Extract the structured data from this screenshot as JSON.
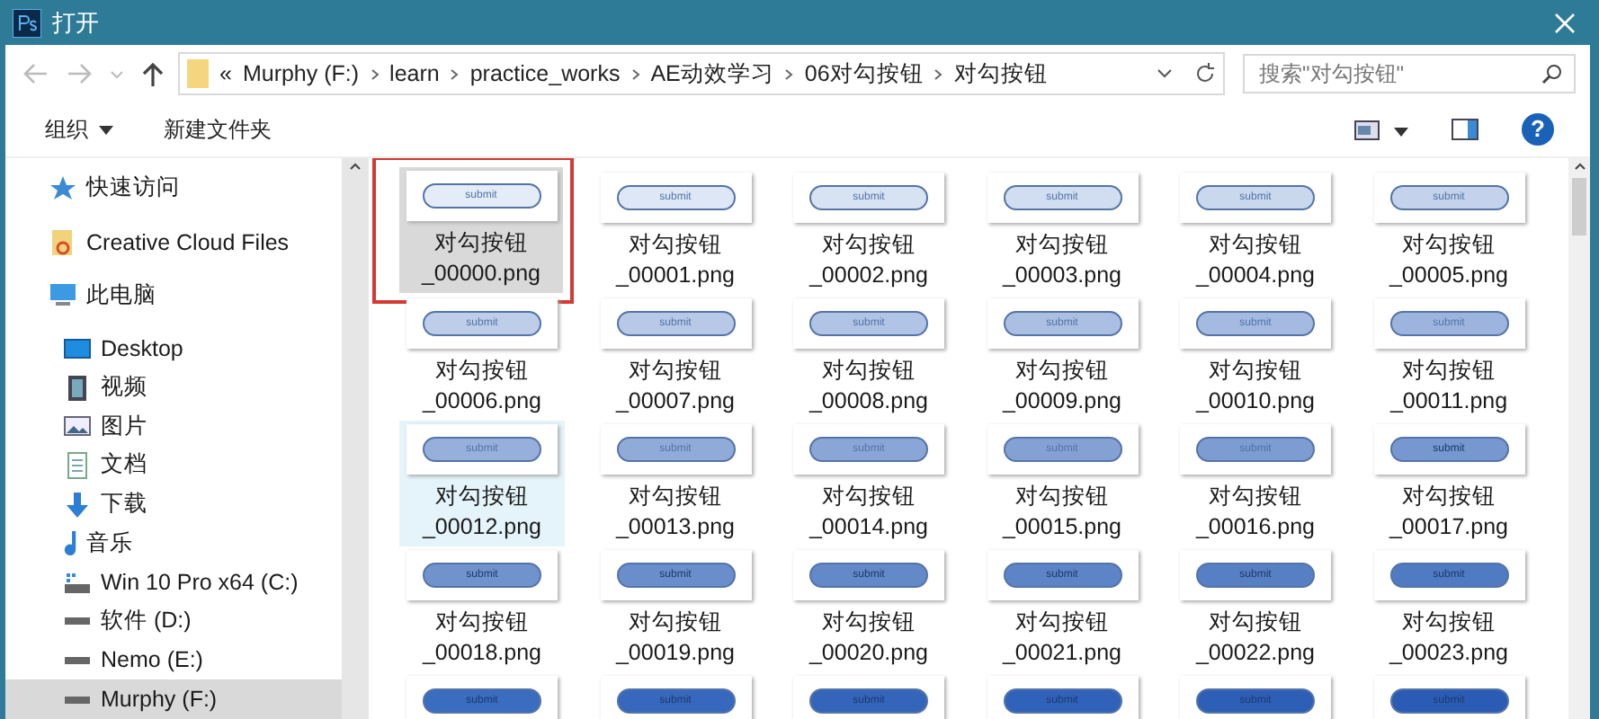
{
  "window": {
    "title": "打开"
  },
  "address_bar": {
    "overflow_mark": "«",
    "path": [
      "Murphy (F:)",
      "learn",
      "practice_works",
      "AE动效学习",
      "06对勾按钮",
      "对勾按钮"
    ]
  },
  "search": {
    "placeholder": "搜索\"对勾按钮\""
  },
  "toolbar": {
    "organize": "组织",
    "new_folder": "新建文件夹",
    "help": "?"
  },
  "sidebar": {
    "items": [
      {
        "label": "快速访问",
        "kind": "star",
        "selected": false
      },
      {
        "label": "Creative Cloud Files",
        "kind": "cloud",
        "selected": false
      },
      {
        "label": "此电脑",
        "kind": "pc",
        "selected": false,
        "children": [
          {
            "label": "Desktop",
            "kind": "desktop",
            "selected": false
          },
          {
            "label": "视频",
            "kind": "video",
            "selected": false
          },
          {
            "label": "图片",
            "kind": "pictures",
            "selected": false
          },
          {
            "label": "文档",
            "kind": "docs",
            "selected": false
          },
          {
            "label": "下载",
            "kind": "download",
            "selected": false
          },
          {
            "label": "音乐",
            "kind": "music",
            "selected": false
          },
          {
            "label": "Win 10 Pro x64 (C:)",
            "kind": "sysdrive",
            "selected": false
          },
          {
            "label": "软件 (D:)",
            "kind": "drive",
            "selected": false
          },
          {
            "label": "Nemo (E:)",
            "kind": "drive",
            "selected": false
          },
          {
            "label": "Murphy (F:)",
            "kind": "drive",
            "selected": true
          }
        ]
      }
    ]
  },
  "files": [
    {
      "name": "对勾按钮\n_00000.png",
      "thumb_text": "submit",
      "color": "#e4ecf7",
      "selected": true,
      "hovered": false,
      "marked": true
    },
    {
      "name": "对勾按钮\n_00001.png",
      "thumb_text": "submit",
      "color": "#dee7f5",
      "selected": false,
      "hovered": false,
      "marked": false
    },
    {
      "name": "对勾按钮\n_00002.png",
      "thumb_text": "submit",
      "color": "#d7e2f2",
      "selected": false,
      "hovered": false,
      "marked": false
    },
    {
      "name": "对勾按钮\n_00003.png",
      "thumb_text": "submit",
      "color": "#d1ddf0",
      "selected": false,
      "hovered": false,
      "marked": false
    },
    {
      "name": "对勾按钮\n_00004.png",
      "thumb_text": "submit",
      "color": "#cad8ee",
      "selected": false,
      "hovered": false,
      "marked": false
    },
    {
      "name": "对勾按钮\n_00005.png",
      "thumb_text": "submit",
      "color": "#c4d3eb",
      "selected": false,
      "hovered": false,
      "marked": false
    },
    {
      "name": "对勾按钮\n_00006.png",
      "thumb_text": "submit",
      "color": "#becee9",
      "selected": false,
      "hovered": false,
      "marked": false
    },
    {
      "name": "对勾按钮\n_00007.png",
      "thumb_text": "submit",
      "color": "#b7c9e7",
      "selected": false,
      "hovered": false,
      "marked": false
    },
    {
      "name": "对勾按钮\n_00008.png",
      "thumb_text": "submit",
      "color": "#b1c4e5",
      "selected": false,
      "hovered": false,
      "marked": false
    },
    {
      "name": "对勾按钮\n_00009.png",
      "thumb_text": "submit",
      "color": "#aabfe2",
      "selected": false,
      "hovered": false,
      "marked": false
    },
    {
      "name": "对勾按钮\n_00010.png",
      "thumb_text": "submit",
      "color": "#a4bae0",
      "selected": false,
      "hovered": false,
      "marked": false
    },
    {
      "name": "对勾按钮\n_00011.png",
      "thumb_text": "submit",
      "color": "#9db5de",
      "selected": false,
      "hovered": false,
      "marked": false
    },
    {
      "name": "对勾按钮\n_00012.png",
      "thumb_text": "submit",
      "color": "#97b0db",
      "selected": false,
      "hovered": true,
      "marked": false
    },
    {
      "name": "对勾按钮\n_00013.png",
      "thumb_text": "submit",
      "color": "#91abd9",
      "selected": false,
      "hovered": false,
      "marked": false
    },
    {
      "name": "对勾按钮\n_00014.png",
      "thumb_text": "submit",
      "color": "#8aa6d7",
      "selected": false,
      "hovered": false,
      "marked": false
    },
    {
      "name": "对勾按钮\n_00015.png",
      "thumb_text": "submit",
      "color": "#84a1d4",
      "selected": false,
      "hovered": false,
      "marked": false
    },
    {
      "name": "对勾按钮\n_00016.png",
      "thumb_text": "submit",
      "color": "#7d9cd2",
      "selected": false,
      "hovered": false,
      "marked": false
    },
    {
      "name": "对勾按钮\n_00017.png",
      "thumb_text": "submit",
      "color": "#7797d0",
      "selected": false,
      "hovered": false,
      "marked": false
    },
    {
      "name": "对勾按钮\n_00018.png",
      "thumb_text": "submit",
      "color": "#7193cd",
      "selected": false,
      "hovered": false,
      "marked": false
    },
    {
      "name": "对勾按钮\n_00019.png",
      "thumb_text": "submit",
      "color": "#6a8ecb",
      "selected": false,
      "hovered": false,
      "marked": false
    },
    {
      "name": "对勾按钮\n_00020.png",
      "thumb_text": "submit",
      "color": "#6489c9",
      "selected": false,
      "hovered": false,
      "marked": false
    },
    {
      "name": "对勾按钮\n_00021.png",
      "thumb_text": "submit",
      "color": "#5d84c6",
      "selected": false,
      "hovered": false,
      "marked": false
    },
    {
      "name": "对勾按钮\n_00022.png",
      "thumb_text": "submit",
      "color": "#577fc4",
      "selected": false,
      "hovered": false,
      "marked": false
    },
    {
      "name": "对勾按钮\n_00023.png",
      "thumb_text": "submit",
      "color": "#507ac2",
      "selected": false,
      "hovered": false,
      "marked": false
    },
    {
      "thumb_text": "submit",
      "color": "#3a6cbf",
      "selected": false,
      "hovered": false,
      "marked": false
    },
    {
      "thumb_text": "submit",
      "color": "#3768bd",
      "selected": false,
      "hovered": false,
      "marked": false
    },
    {
      "thumb_text": "submit",
      "color": "#3465bb",
      "selected": false,
      "hovered": false,
      "marked": false
    },
    {
      "thumb_text": "submit",
      "color": "#3162b9",
      "selected": false,
      "hovered": false,
      "marked": false
    },
    {
      "thumb_text": "submit",
      "color": "#2e5fb7",
      "selected": false,
      "hovered": false,
      "marked": false
    },
    {
      "thumb_text": "submit",
      "color": "#2b5cb5",
      "selected": false,
      "hovered": false,
      "marked": false
    }
  ]
}
